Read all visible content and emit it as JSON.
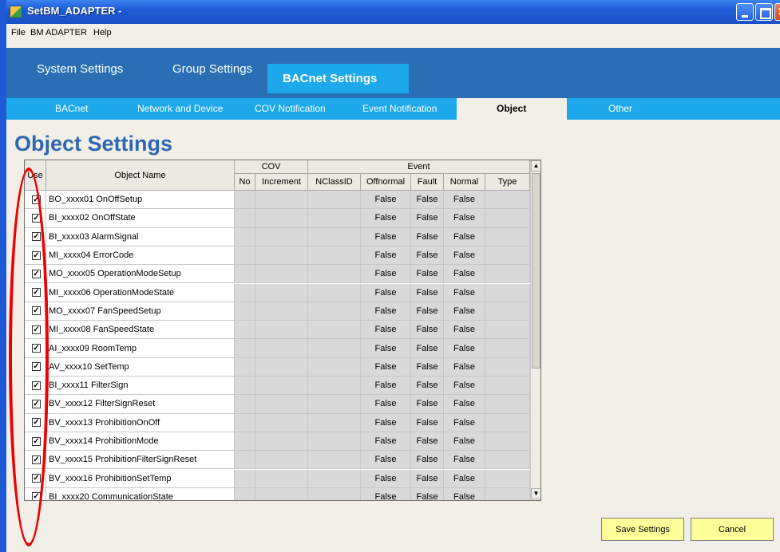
{
  "window": {
    "title": "SetBM_ADAPTER -"
  },
  "menu": {
    "items": [
      "File",
      "BM ADAPTER",
      "Help"
    ]
  },
  "main_tabs": [
    "System Settings",
    "Group Settings",
    "BACnet Settings"
  ],
  "active_main_tab": "BACnet Settings",
  "sub_tabs": [
    "BACnet",
    "Network and Device",
    "COV Notification",
    "Event Notification",
    "Object",
    "Other"
  ],
  "active_sub_tab": "Object",
  "page_title": "Object Settings",
  "grid": {
    "headers": {
      "use": "Use",
      "object_name": "Object Name",
      "cov": "COV",
      "cov_no": "No",
      "cov_increment": "Increment",
      "event": "Event",
      "nclassid": "NClassID",
      "offnormal": "Offnormal",
      "fault": "Fault",
      "normal": "Normal",
      "type": "Type"
    },
    "rows": [
      {
        "use": true,
        "name": "BO_xxxx01 OnOffSetup",
        "offnormal": "False",
        "fault": "False",
        "normal": "False"
      },
      {
        "use": true,
        "name": "BI_xxxx02 OnOffState",
        "offnormal": "False",
        "fault": "False",
        "normal": "False"
      },
      {
        "use": true,
        "name": "BI_xxxx03 AlarmSignal",
        "offnormal": "False",
        "fault": "False",
        "normal": "False"
      },
      {
        "use": true,
        "name": "MI_xxxx04 ErrorCode",
        "offnormal": "False",
        "fault": "False",
        "normal": "False"
      },
      {
        "use": true,
        "name": "MO_xxxx05 OperationModeSetup",
        "offnormal": "False",
        "fault": "False",
        "normal": "False"
      },
      {
        "use": true,
        "name": "MI_xxxx06 OperationModeState",
        "offnormal": "False",
        "fault": "False",
        "normal": "False"
      },
      {
        "use": true,
        "name": "MO_xxxx07 FanSpeedSetup",
        "offnormal": "False",
        "fault": "False",
        "normal": "False"
      },
      {
        "use": true,
        "name": "MI_xxxx08 FanSpeedState",
        "offnormal": "False",
        "fault": "False",
        "normal": "False"
      },
      {
        "use": true,
        "name": "AI_xxxx09 RoomTemp",
        "offnormal": "False",
        "fault": "False",
        "normal": "False"
      },
      {
        "use": true,
        "name": "AV_xxxx10 SetTemp",
        "offnormal": "False",
        "fault": "False",
        "normal": "False"
      },
      {
        "use": true,
        "name": "BI_xxxx11 FilterSign",
        "offnormal": "False",
        "fault": "False",
        "normal": "False"
      },
      {
        "use": true,
        "name": "BV_xxxx12 FilterSignReset",
        "offnormal": "False",
        "fault": "False",
        "normal": "False"
      },
      {
        "use": true,
        "name": "BV_xxxx13 ProhibitionOnOff",
        "offnormal": "False",
        "fault": "False",
        "normal": "False"
      },
      {
        "use": true,
        "name": "BV_xxxx14 ProhibitionMode",
        "offnormal": "False",
        "fault": "False",
        "normal": "False"
      },
      {
        "use": true,
        "name": "BV_xxxx15 ProhibitionFilterSignReset",
        "offnormal": "False",
        "fault": "False",
        "normal": "False"
      },
      {
        "use": true,
        "name": "BV_xxxx16 ProhibitionSetTemp",
        "offnormal": "False",
        "fault": "False",
        "normal": "False"
      },
      {
        "use": true,
        "name": "BI_xxxx20 CommunicationState",
        "offnormal": "False",
        "fault": "False",
        "normal": "False"
      }
    ]
  },
  "buttons": {
    "save": "Save Settings",
    "cancel": "Cancel"
  }
}
